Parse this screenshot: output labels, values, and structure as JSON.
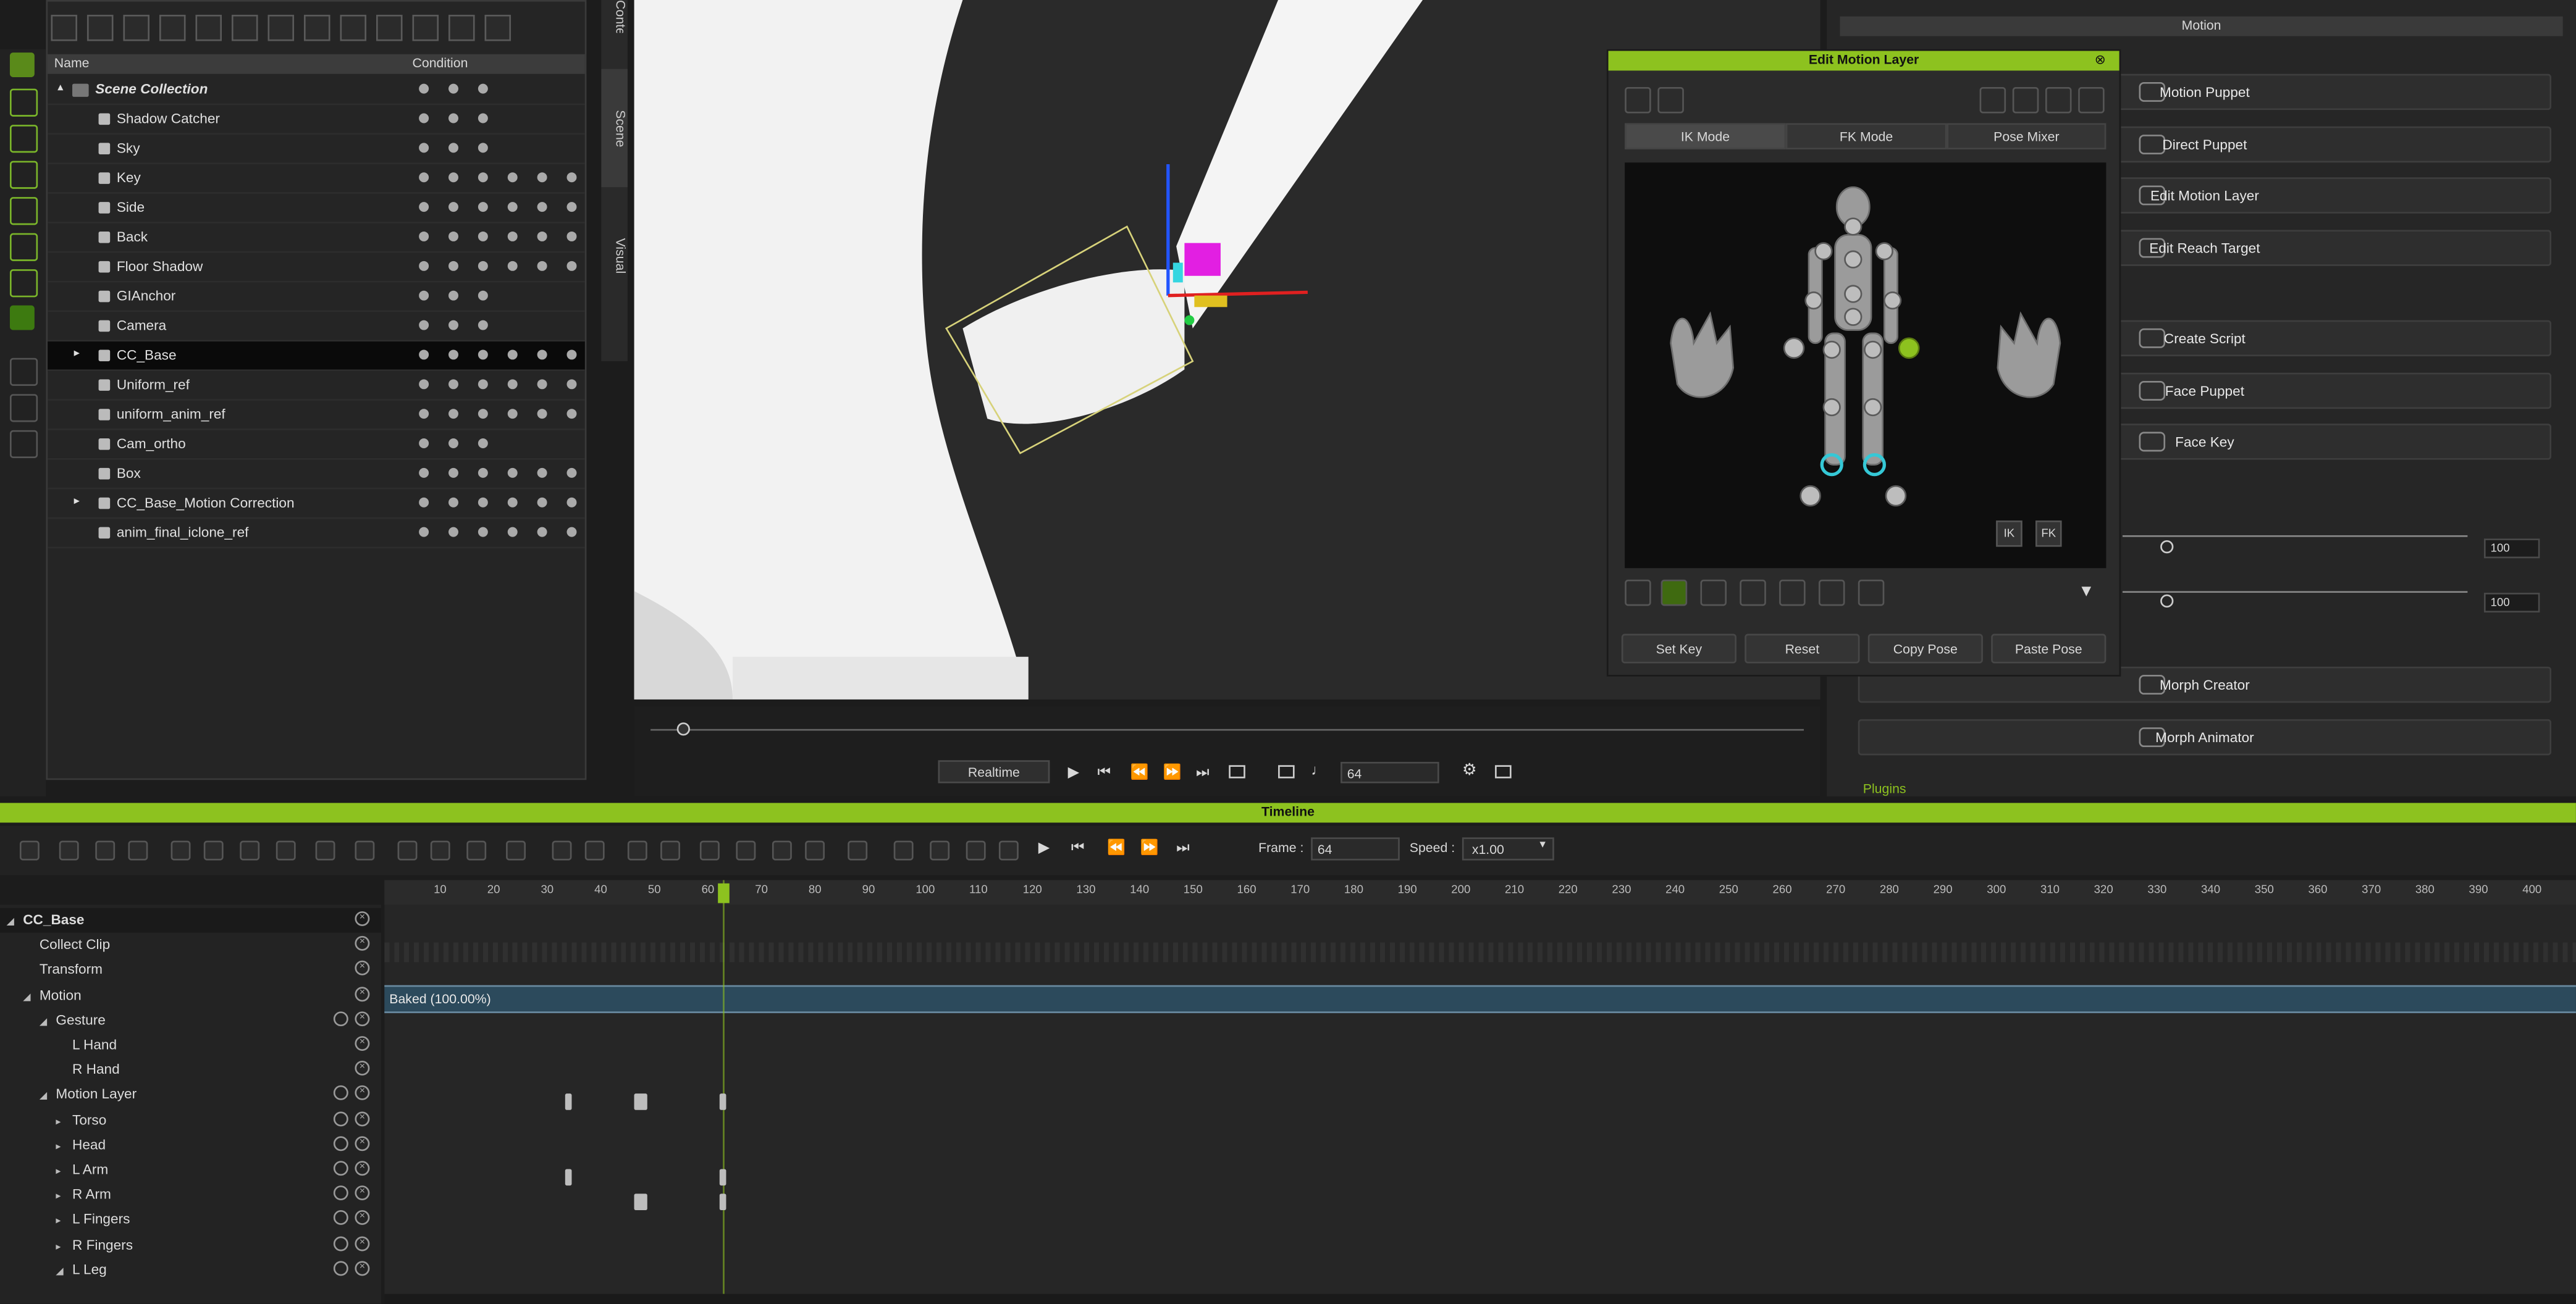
{
  "scene_manager": {
    "col_name": "Name",
    "col_condition": "Condition",
    "items": [
      {
        "label": "Scene Collection",
        "icon": "collection-icon",
        "expander": "▴"
      },
      {
        "label": "Shadow Catcher",
        "icon": "object-icon"
      },
      {
        "label": "Sky",
        "icon": "sky-icon"
      },
      {
        "label": "Key",
        "icon": "light-icon"
      },
      {
        "label": "Side",
        "icon": "light-icon"
      },
      {
        "label": "Back",
        "icon": "light-icon"
      },
      {
        "label": "Floor Shadow",
        "icon": "light-icon"
      },
      {
        "label": "GIAnchor",
        "icon": "anchor-icon"
      },
      {
        "label": "Camera",
        "icon": "camera-icon"
      },
      {
        "label": "CC_Base",
        "icon": "avatar-icon",
        "expander": "▸"
      },
      {
        "label": "Uniform_ref",
        "icon": "object-icon"
      },
      {
        "label": "uniform_anim_ref",
        "icon": "object-icon"
      },
      {
        "label": "Cam_ortho",
        "icon": "camera-icon"
      },
      {
        "label": "Box",
        "icon": "object-icon"
      },
      {
        "label": "CC_Base_Motion Correction",
        "icon": "object-icon",
        "expander": "▸"
      },
      {
        "label": "anim_final_iclone_ref",
        "icon": "object-icon"
      }
    ]
  },
  "side_tabs": [
    "Content",
    "Scene",
    "Visual"
  ],
  "playback": {
    "realtime_label": "Realtime",
    "frame_value": "64"
  },
  "right_panel": {
    "section_title": "Motion",
    "buttons": [
      "Motion Puppet",
      "Direct Puppet",
      "Edit Motion Layer",
      "Edit Reach Target",
      "Create Script",
      "Face Puppet",
      "Face Key",
      "Morph Creator",
      "Morph Animator"
    ],
    "slider1_value": "100",
    "slider2_value": "100",
    "plugins_label": "Plugins"
  },
  "dialog": {
    "title": "Edit Motion Layer",
    "tabs": [
      "IK Mode",
      "FK Mode",
      "Pose Mixer"
    ],
    "ik_label": "IK",
    "fk_label": "FK",
    "buttons": [
      "Set Key",
      "Reset",
      "Copy Pose",
      "Paste Pose"
    ]
  },
  "timeline": {
    "title": "Timeline",
    "frame_label": "Frame :",
    "frame_value": "64",
    "speed_label": "Speed :",
    "speed_value": "x1.00",
    "ticks": [
      "10",
      "20",
      "30",
      "40",
      "50",
      "60",
      "70",
      "80",
      "90",
      "100",
      "110",
      "120",
      "130",
      "140",
      "150",
      "160",
      "170",
      "180",
      "190",
      "200",
      "210",
      "220",
      "230",
      "240",
      "250",
      "260",
      "270",
      "280",
      "290",
      "300",
      "310",
      "320",
      "330",
      "340",
      "350",
      "360",
      "370",
      "380",
      "390",
      "400"
    ],
    "tracks": [
      {
        "label": "CC_Base",
        "indent": 14,
        "expander": "◢",
        "bold": true
      },
      {
        "label": "Collect Clip",
        "indent": 24
      },
      {
        "label": "Transform",
        "indent": 24
      },
      {
        "label": "Motion",
        "indent": 24,
        "expander": "◢"
      },
      {
        "label": "Gesture",
        "indent": 34,
        "expander": "◢"
      },
      {
        "label": "L Hand",
        "indent": 44
      },
      {
        "label": "R Hand",
        "indent": 44
      },
      {
        "label": "Motion Layer",
        "indent": 34,
        "expander": "◢"
      },
      {
        "label": "Torso",
        "indent": 44,
        "expander": "▸"
      },
      {
        "label": "Head",
        "indent": 44,
        "expander": "▸"
      },
      {
        "label": "L Arm",
        "indent": 44,
        "expander": "▸"
      },
      {
        "label": "R Arm",
        "indent": 44,
        "expander": "▸"
      },
      {
        "label": "L Fingers",
        "indent": 44,
        "expander": "▸"
      },
      {
        "label": "R Fingers",
        "indent": 44,
        "expander": "▸"
      },
      {
        "label": "L Leg",
        "indent": 44,
        "expander": "◢"
      }
    ],
    "clip_label": "Baked (100.00%)"
  },
  "colors": {
    "accent": "#8dc21f",
    "clip": "#2c4a5c"
  }
}
